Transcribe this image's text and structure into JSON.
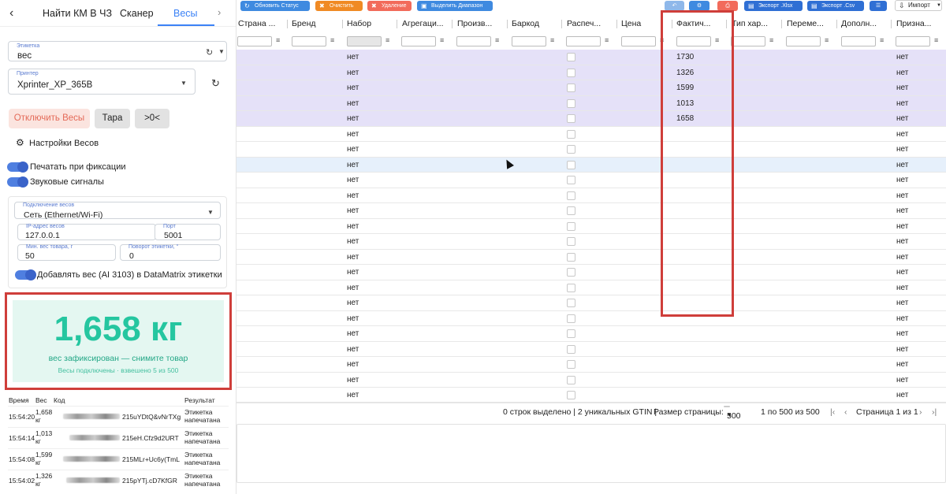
{
  "nav": {
    "tabs": [
      "Найти КМ В ЧЗ",
      "Сканер",
      "Весы"
    ],
    "active_tab": "Весы"
  },
  "label_field": {
    "label": "Этикетка",
    "value": "вес"
  },
  "printer_field": {
    "label": "Принтер",
    "value": "Xprinter_XP_365B"
  },
  "buttons": {
    "disconnect": "Отключить Весы",
    "tare": "Тара",
    "zero": ">0<"
  },
  "settings_title": "Настройки Весов",
  "toggles": {
    "print_on_fix": "Печатать при фиксации",
    "sound": "Звуковые сигналы",
    "add_weight": "Добавлять вес (AI 3103) в DataMatrix этикетки"
  },
  "connection": {
    "type_label": "Подключение весов",
    "type_value": "Сеть (Ethernet/Wi-Fi)",
    "ip_label": "IP-адрес весов",
    "ip_value": "127.0.0.1",
    "port_label": "Порт",
    "port_value": "5001",
    "minw_label": "Мин. вес товара, г",
    "minw_value": "50",
    "rot_label": "Поворот этикетки, °",
    "rot_value": "0"
  },
  "weight": {
    "value": "1,658 кг",
    "status": "вес зафиксирован — снимите товар",
    "info": "Весы подключены · взвешено 5 из 500"
  },
  "log": {
    "headers": {
      "time": "Время",
      "weight": "Вес",
      "code": "Код",
      "result": "Результат"
    },
    "rows": [
      {
        "time": "15:54:20",
        "weight": "1,658",
        "unit": "кг",
        "code": "215uYDtQ&vNrTXg",
        "result1": "Этикетка",
        "result2": "напечатана"
      },
      {
        "time": "15:54:14",
        "weight": "1,013",
        "unit": "кг",
        "code": "215eH.Cfz9d2URT",
        "result1": "Этикетка",
        "result2": "напечатана"
      },
      {
        "time": "15:54:08",
        "weight": "1,599",
        "unit": "кг",
        "code": "215MLr+Uc6y(TmL",
        "result1": "Этикетка",
        "result2": "напечатана"
      },
      {
        "time": "15:54:02",
        "weight": "1,326",
        "unit": "кг",
        "code": "215pYTj.cD7KfGR",
        "result1": "Этикетка",
        "result2": "напечатана"
      }
    ]
  },
  "toolbar": {
    "update_status": "Обновить Статус",
    "clear": "Очистить",
    "delete": "Удаление",
    "select_range": "Выделить Диапазон",
    "export_xlsx": "Экспорт .Xlsx",
    "export_csv": "Экспорт .Csv",
    "import": "Импорт"
  },
  "grid": {
    "columns": [
      "Страна ...",
      "Бренд",
      "Набор",
      "Агрегаци...",
      "Произв...",
      "Баркод",
      "Распеч...",
      "Цена",
      "Фактич...",
      "Тип хар...",
      "Переме...",
      "Дополн...",
      "Призна..."
    ],
    "no_value": "нет",
    "rows": [
      {
        "sel": true,
        "fact": "1730"
      },
      {
        "sel": true,
        "fact": "1326"
      },
      {
        "sel": true,
        "fact": "1599"
      },
      {
        "sel": true,
        "fact": "1013"
      },
      {
        "sel": true,
        "fact": "1658"
      },
      {
        "sel": false,
        "fact": ""
      },
      {
        "sel": false,
        "fact": ""
      },
      {
        "sel": false,
        "fact": "",
        "hl": true
      },
      {
        "sel": false,
        "fact": ""
      },
      {
        "sel": false,
        "fact": ""
      },
      {
        "sel": false,
        "fact": ""
      },
      {
        "sel": false,
        "fact": ""
      },
      {
        "sel": false,
        "fact": ""
      },
      {
        "sel": false,
        "fact": ""
      },
      {
        "sel": false,
        "fact": ""
      },
      {
        "sel": false,
        "fact": ""
      },
      {
        "sel": false,
        "fact": ""
      },
      {
        "sel": false,
        "fact": ""
      },
      {
        "sel": false,
        "fact": ""
      },
      {
        "sel": false,
        "fact": ""
      },
      {
        "sel": false,
        "fact": ""
      },
      {
        "sel": false,
        "fact": ""
      },
      {
        "sel": false,
        "fact": ""
      },
      {
        "sel": false,
        "fact": ""
      }
    ]
  },
  "footer": {
    "summary": "0 строк выделено | 2 уникальных GTIN |",
    "page_size_label": "Размер страницы:",
    "page_size": "500",
    "range": "1 по 500 из 500",
    "page": "Страница 1 из 1"
  },
  "colors": {
    "accent": "#3b82f6",
    "weight_green": "#25c6a0",
    "selected_row": "#e5e1f8",
    "highlight_red": "#cf3e3a"
  }
}
